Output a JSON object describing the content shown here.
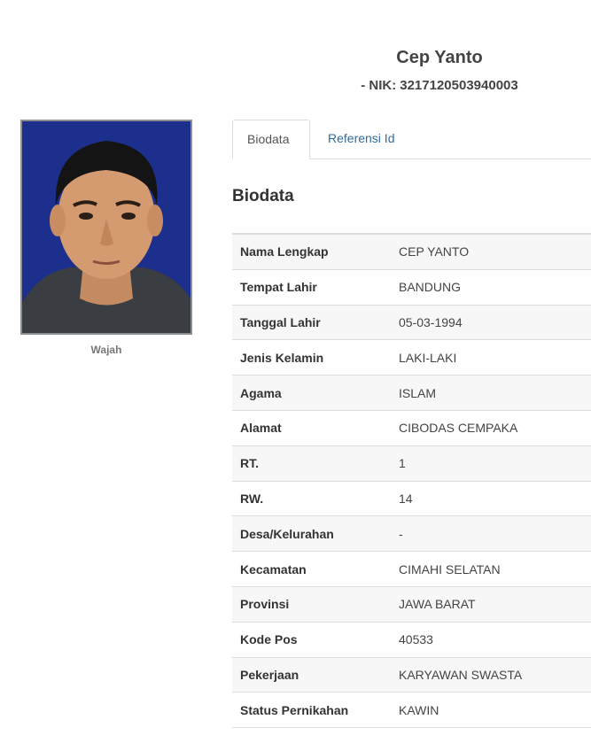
{
  "profile": {
    "name": "Cep Yanto",
    "nik_label": "- NIK:",
    "nik_value": "3217120503940003"
  },
  "photo": {
    "caption": "Wajah",
    "background_color": "#1c2f8c"
  },
  "tabs": [
    {
      "label": "Biodata",
      "active": true
    },
    {
      "label": "Referensi Id",
      "active": false
    }
  ],
  "section": {
    "title": "Biodata"
  },
  "biodata": [
    {
      "label": "Nama Lengkap",
      "value": "CEP YANTO"
    },
    {
      "label": "Tempat Lahir",
      "value": "BANDUNG"
    },
    {
      "label": "Tanggal Lahir",
      "value": "05-03-1994"
    },
    {
      "label": "Jenis Kelamin",
      "value": "LAKI-LAKI"
    },
    {
      "label": "Agama",
      "value": "ISLAM"
    },
    {
      "label": "Alamat",
      "value": "CIBODAS CEMPAKA"
    },
    {
      "label": "RT.",
      "value": "1"
    },
    {
      "label": "RW.",
      "value": "14"
    },
    {
      "label": "Desa/Kelurahan",
      "value": "-"
    },
    {
      "label": "Kecamatan",
      "value": "CIMAHI SELATAN"
    },
    {
      "label": "Provinsi",
      "value": "JAWA BARAT"
    },
    {
      "label": "Kode Pos",
      "value": "40533"
    },
    {
      "label": "Pekerjaan",
      "value": "KARYAWAN SWASTA"
    },
    {
      "label": "Status Pernikahan",
      "value": "KAWIN"
    }
  ],
  "colors": {
    "link": "#2e6da4",
    "border": "#dddddd",
    "stripe": "#f7f7f7"
  }
}
